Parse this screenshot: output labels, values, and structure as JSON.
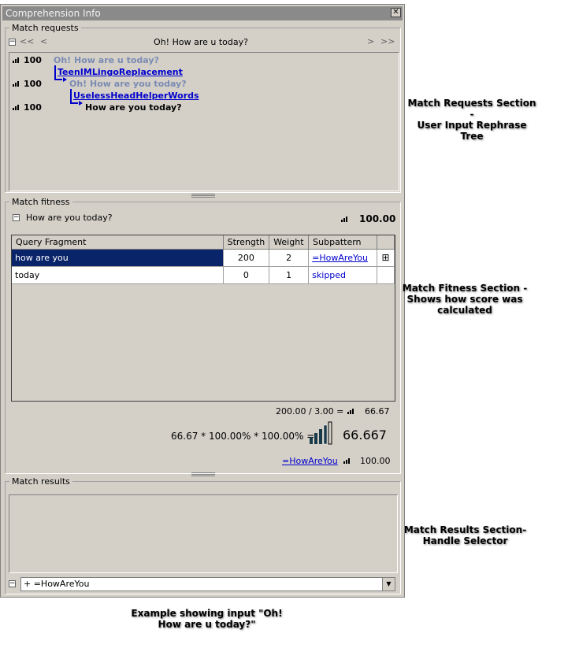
{
  "window": {
    "title": "Comprehension Info",
    "close_glyph": "✕"
  },
  "match_requests": {
    "legend": "Match requests",
    "nav": {
      "first": "<<",
      "prev": "<",
      "title": "Oh! How are u today?",
      "next": ">",
      "last": ">>"
    },
    "rows": [
      {
        "score": "100",
        "text": "Oh! How are u today?"
      },
      {
        "link": "TeenIMLingoReplacement"
      },
      {
        "score": "100",
        "text": "Oh! How are you today?"
      },
      {
        "link": "UselessHeadHelperWords"
      },
      {
        "score": "100",
        "text": "How are you today?"
      }
    ]
  },
  "match_fitness": {
    "legend": "Match fitness",
    "query": "How are you today?",
    "score": "100.00",
    "columns": [
      "Query Fragment",
      "Strength",
      "Weight",
      "Subpattern"
    ],
    "rows": [
      {
        "fragment": "how are you",
        "strength": "200",
        "weight": "2",
        "subpattern": "=HowAreYou",
        "expand": "⊞"
      },
      {
        "fragment": "today",
        "strength": "0",
        "weight": "1",
        "subpattern": "skipped",
        "expand": ""
      }
    ],
    "division": "200.00 / 3.00 =",
    "division_result": "66.67",
    "product": "66.67 * 100.00% * 100.00% =",
    "final_score": "66.667",
    "pattern_link": "=HowAreYou",
    "pattern_score": "100.00"
  },
  "match_results": {
    "legend": "Match results",
    "handle_selector_value": "+ =HowAreYou"
  },
  "annotations": {
    "requests": [
      "Match Requests Section -",
      "User Input Rephrase Tree"
    ],
    "fitness": [
      "Match Fitness Section -",
      "Shows how score was",
      "calculated"
    ],
    "results": [
      "Match Results Section-",
      "Handle Selector"
    ],
    "caption": [
      "Example showing input \"Oh!",
      "How are u today?\""
    ]
  },
  "colors": {
    "window_bg": "#d4d0c8",
    "selection": "#0a246a",
    "link": "#0000cc",
    "grey_node": "#7b8bb3"
  },
  "icons": {
    "signal": "signal-strength-icon",
    "collapse": "collapse-icon",
    "dropdown": "chevron-down-icon"
  }
}
